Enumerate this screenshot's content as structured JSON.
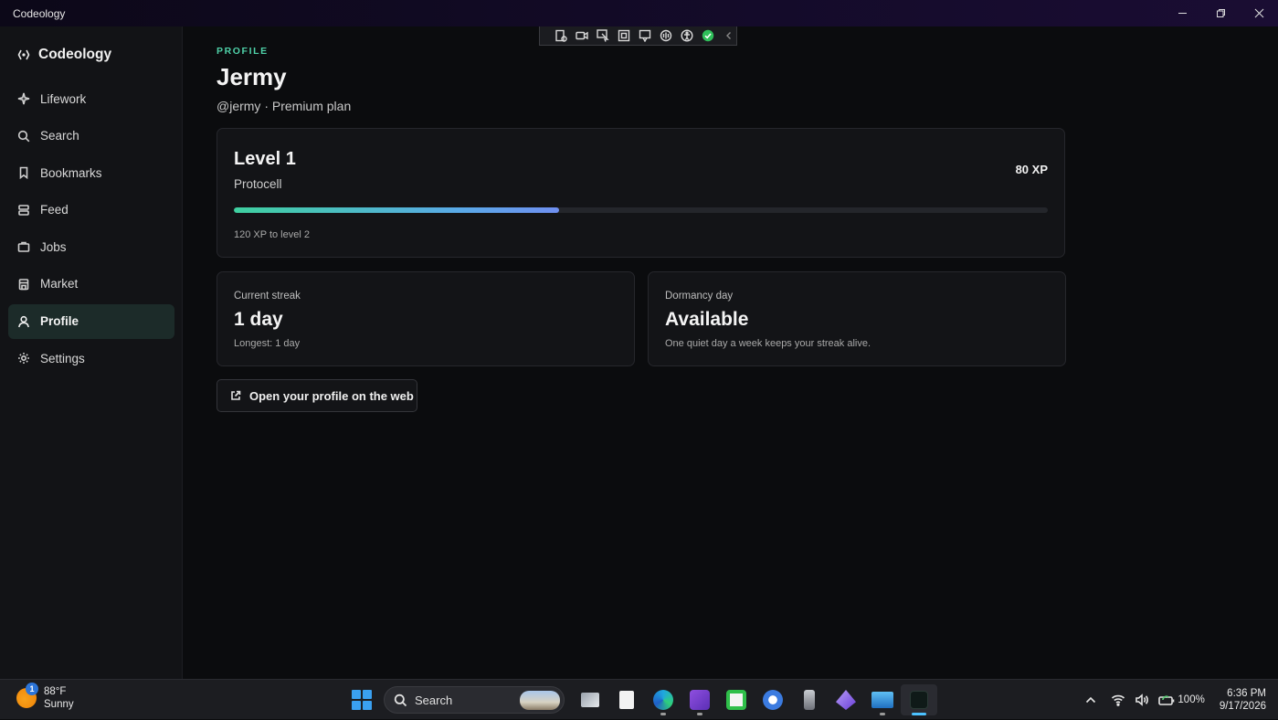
{
  "window": {
    "title": "Codeology"
  },
  "sidebar": {
    "brand": "Codeology",
    "items": [
      {
        "label": "Lifework",
        "icon": "sparkle-icon"
      },
      {
        "label": "Search",
        "icon": "search-icon"
      },
      {
        "label": "Bookmarks",
        "icon": "bookmark-icon"
      },
      {
        "label": "Feed",
        "icon": "feed-icon"
      },
      {
        "label": "Jobs",
        "icon": "briefcase-icon"
      },
      {
        "label": "Market",
        "icon": "store-icon"
      },
      {
        "label": "Profile",
        "icon": "user-icon",
        "active": true
      },
      {
        "label": "Settings",
        "icon": "gear-icon"
      }
    ]
  },
  "profile": {
    "eyebrow": "PROFILE",
    "name": "Jermy",
    "subtitle": "@jermy · Premium plan",
    "level": {
      "title": "Level 1",
      "rank": "Protocell",
      "xp": "80 XP",
      "progress_fraction": 0.4,
      "to_next": "120 XP to level 2"
    },
    "streak": {
      "label": "Current streak",
      "value": "1 day",
      "note": "Longest: 1 day"
    },
    "dormancy": {
      "label": "Dormancy day",
      "value": "Available",
      "note": "One quiet day a week keeps your streak alive."
    },
    "web_button": "Open your profile on the web"
  },
  "taskbar": {
    "weather": {
      "temp": "88°F",
      "condition": "Sunny",
      "badge": "1"
    },
    "search_placeholder": "Search",
    "battery": "100%",
    "time": "6:36 PM",
    "date": "9/17/2026"
  },
  "colors": {
    "accent": "#4fd1a8",
    "progress_start": "#3fd0a0",
    "progress_end": "#6f8ff0"
  }
}
